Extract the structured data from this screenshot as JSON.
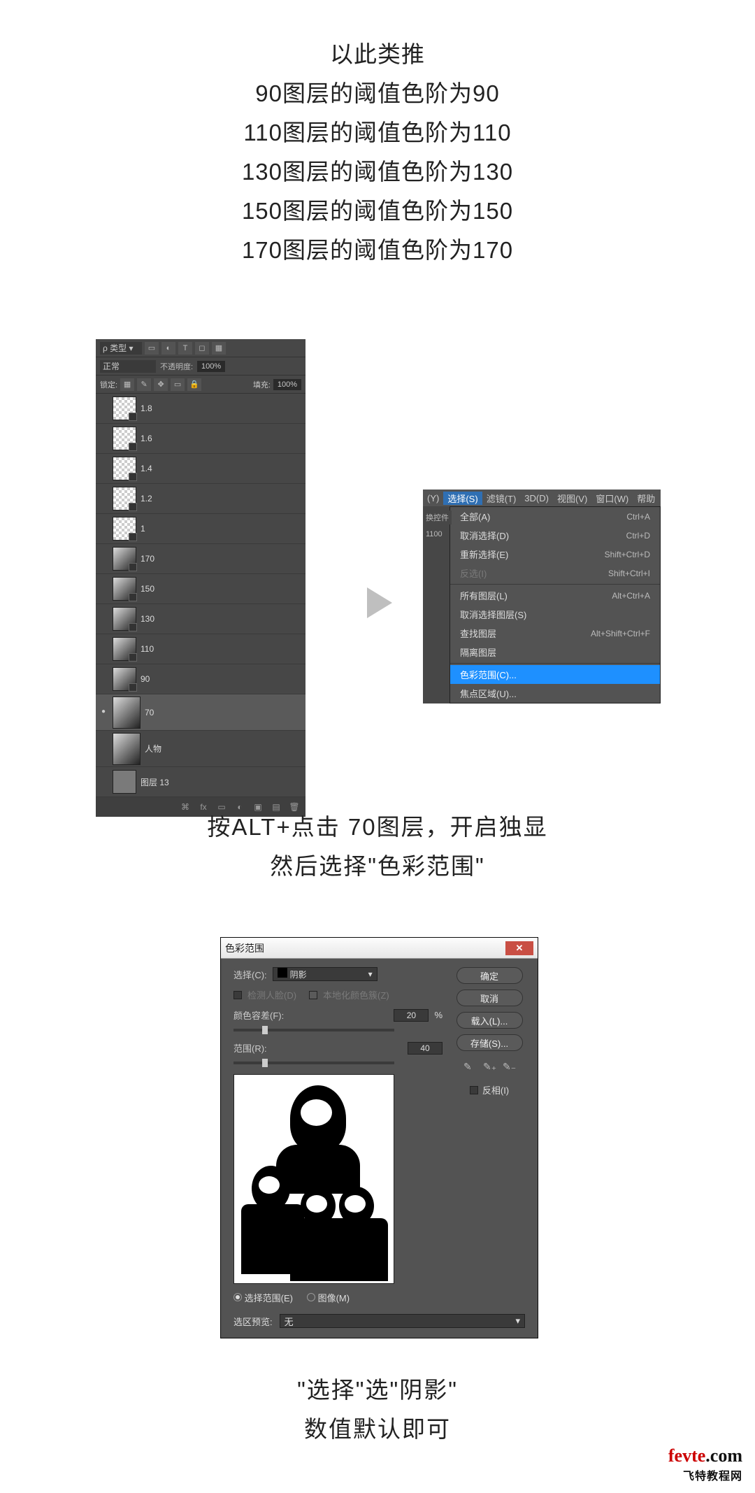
{
  "intro": {
    "l1": "以此类推",
    "l2": "90图层的阈值色阶为90",
    "l3": "110图层的阈值色阶为110",
    "l4": "130图层的阈值色阶为130",
    "l5": "150图层的阈值色阶为150",
    "l6": "170图层的阈值色阶为170"
  },
  "layers_panel": {
    "search_label": "ρ 类型",
    "blend_mode": "正常",
    "opacity_label": "不透明度:",
    "opacity_value": "100%",
    "lock_label": "锁定:",
    "fill_label": "填充:",
    "fill_value": "100%",
    "layers": [
      {
        "name": "1.8",
        "thumb": "trans",
        "eye": false
      },
      {
        "name": "1.6",
        "thumb": "trans",
        "eye": false
      },
      {
        "name": "1.4",
        "thumb": "trans",
        "eye": false
      },
      {
        "name": "1.2",
        "thumb": "trans",
        "eye": false
      },
      {
        "name": "1",
        "thumb": "trans",
        "eye": false
      },
      {
        "name": "170",
        "thumb": "photo",
        "eye": false
      },
      {
        "name": "150",
        "thumb": "photo",
        "eye": false
      },
      {
        "name": "130",
        "thumb": "photo",
        "eye": false
      },
      {
        "name": "110",
        "thumb": "photo",
        "eye": false
      },
      {
        "name": "90",
        "thumb": "photo",
        "eye": false
      },
      {
        "name": "70",
        "thumb": "photo",
        "eye": true,
        "selected": true,
        "tall": true
      },
      {
        "name": "人物",
        "thumb": "photo",
        "eye": false,
        "tall": true
      },
      {
        "name": "图层 13",
        "thumb": "gray",
        "eye": false
      }
    ]
  },
  "menu": {
    "bar": {
      "y": "(Y)",
      "select": "选择(S)",
      "filter": "滤镜(T)",
      "threeD": "3D(D)",
      "view": "视图(V)",
      "window": "窗口(W)",
      "help": "帮助"
    },
    "side1": "换控件",
    "side2": "1100",
    "items": [
      {
        "label": "全部(A)",
        "shortcut": "Ctrl+A"
      },
      {
        "label": "取消选择(D)",
        "shortcut": "Ctrl+D"
      },
      {
        "label": "重新选择(E)",
        "shortcut": "Shift+Ctrl+D"
      },
      {
        "label": "反选(I)",
        "shortcut": "Shift+Ctrl+I",
        "disabled": true
      },
      {
        "sep": true
      },
      {
        "label": "所有图层(L)",
        "shortcut": "Alt+Ctrl+A"
      },
      {
        "label": "取消选择图层(S)",
        "shortcut": ""
      },
      {
        "label": "查找图层",
        "shortcut": "Alt+Shift+Ctrl+F"
      },
      {
        "label": "隔离图层",
        "shortcut": ""
      },
      {
        "sep": true
      },
      {
        "label": "色彩范围(C)...",
        "shortcut": "",
        "highlight": true
      },
      {
        "label": "焦点区域(U)...",
        "shortcut": ""
      }
    ]
  },
  "mid_caption": {
    "l1": "按ALT+点击 70图层，开启独显",
    "l2": "然后选择\"色彩范围\""
  },
  "dialog": {
    "title": "色彩范围",
    "select_label": "选择(C):",
    "select_value": "阴影",
    "detect_faces": "检测人脸(D)",
    "localized": "本地化颜色簇(Z)",
    "fuzziness_label": "颜色容差(F):",
    "fuzziness_value": "20",
    "percent": "%",
    "range_label": "范围(R):",
    "range_value": "40",
    "radio_selection": "选择范围(E)",
    "radio_image": "图像(M)",
    "preview_label": "选区预览:",
    "preview_value": "无",
    "btn_ok": "确定",
    "btn_cancel": "取消",
    "btn_load": "载入(L)...",
    "btn_save": "存储(S)...",
    "invert_label": "反相(I)"
  },
  "bot_caption": {
    "l1": "\"选择\"选\"阴影\"",
    "l2": "数值默认即可"
  },
  "watermark": {
    "brand1": "fevte",
    "brand2": ".com",
    "sub": "飞特教程网"
  }
}
